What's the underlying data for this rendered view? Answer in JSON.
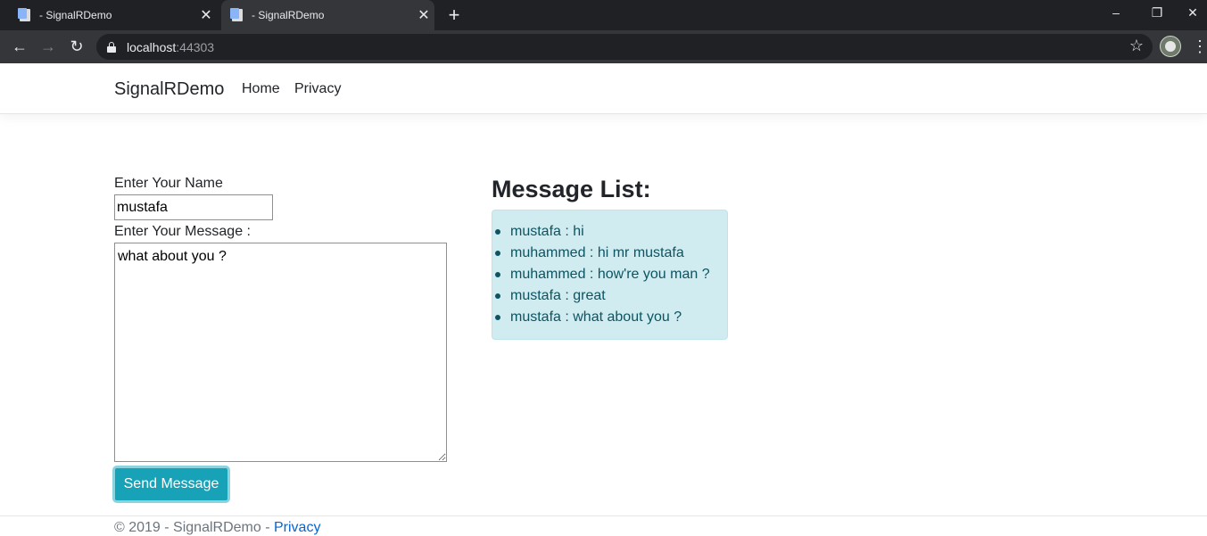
{
  "browser": {
    "tabs": [
      {
        "title": "- SignalRDemo",
        "active": false
      },
      {
        "title": "- SignalRDemo",
        "active": true
      }
    ],
    "new_tab_icon": "plus-icon",
    "window_controls": {
      "minimize": "–",
      "restore": "❐",
      "close": "✕"
    },
    "address": {
      "host": "localhost",
      "port": ":44303"
    }
  },
  "site": {
    "brand": "SignalRDemo",
    "nav": [
      {
        "label": "Home"
      },
      {
        "label": "Privacy"
      }
    ]
  },
  "form": {
    "name_label": "Enter Your Name",
    "name_value": "mustafa",
    "message_label": "Enter Your Message :",
    "message_value": "what about you ?",
    "send_label": "Send Message"
  },
  "messages": {
    "heading": "Message List:",
    "items": [
      "mustafa : hi",
      "muhammed : hi mr mustafa",
      "muhammed : how're you man ?",
      "mustafa : great",
      "mustafa : what about you ?"
    ]
  },
  "footer": {
    "text": "© 2019 - SignalRDemo - ",
    "link": "Privacy"
  },
  "colors": {
    "button": "#17a2b8",
    "panel_bg": "#d1ecf1",
    "panel_text": "#0c5460",
    "link": "#0366d6"
  }
}
